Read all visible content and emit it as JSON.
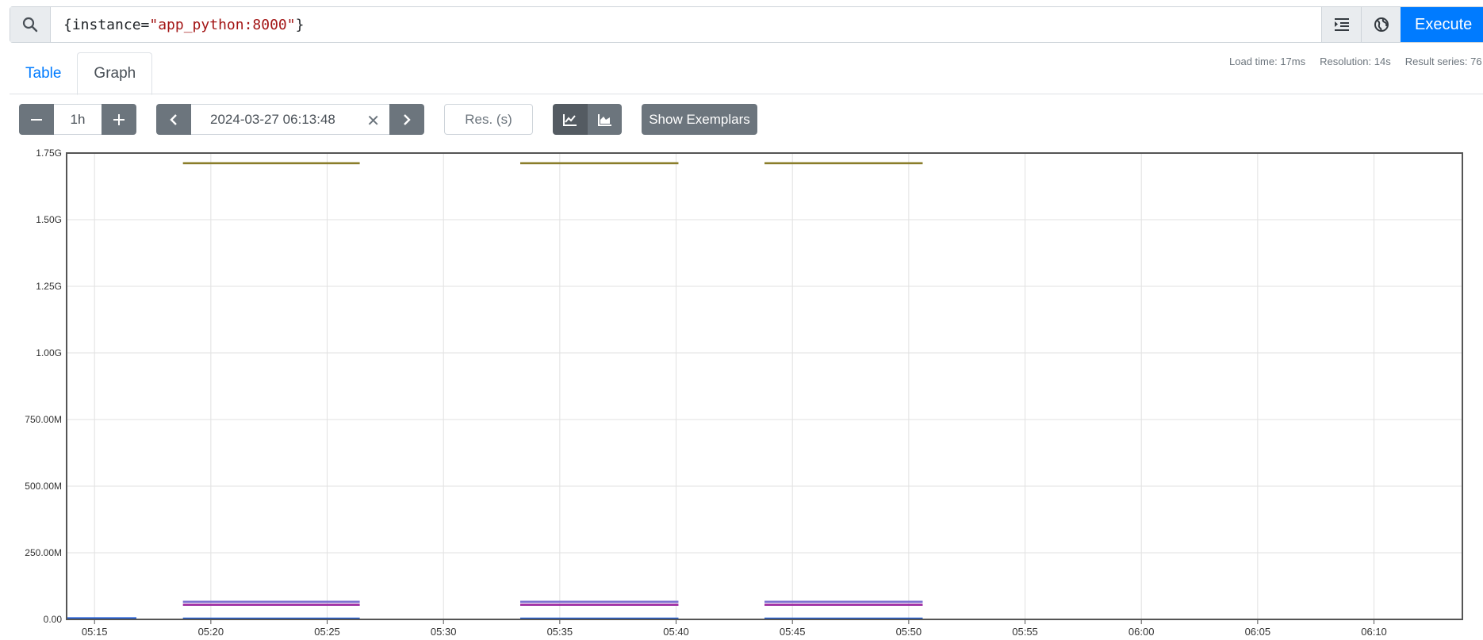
{
  "query": {
    "prefix": "{instance=",
    "string": "\"app_python:8000\"",
    "suffix": "}"
  },
  "buttons": {
    "execute": "Execute"
  },
  "tabs": [
    {
      "label": "Table",
      "active": false
    },
    {
      "label": "Graph",
      "active": true
    }
  ],
  "stats": {
    "load_time": "Load time: 17ms",
    "resolution": "Resolution: 14s",
    "result_series": "Result series: 76"
  },
  "controls": {
    "range": "1h",
    "end_time": "2024-03-27 06:13:48",
    "resolution_placeholder": "Res. (s)",
    "show_exemplars": "Show Exemplars"
  },
  "colors": {
    "accent": "#007bff",
    "button_dark": "#6c757d"
  },
  "chart_data": {
    "type": "line",
    "y_tick_labels": [
      "0.00",
      "250.00M",
      "500.00M",
      "750.00M",
      "1.00G",
      "1.25G",
      "1.50G",
      "1.75G"
    ],
    "y_tick_values": [
      0,
      250000000,
      500000000,
      750000000,
      1000000000,
      1250000000,
      1500000000,
      1750000000
    ],
    "ylim": [
      0,
      1750000000
    ],
    "x_tick_labels": [
      "05:15",
      "05:20",
      "05:25",
      "05:30",
      "05:35",
      "05:40",
      "05:45",
      "05:50",
      "05:55",
      "06:00",
      "06:05",
      "06:10"
    ],
    "x_tick_minutes": [
      315,
      320,
      325,
      330,
      335,
      340,
      345,
      350,
      355,
      360,
      365,
      370
    ],
    "xlim_minutes": [
      313.8,
      373.8
    ],
    "grid": true,
    "segments": [
      {
        "start": 313.8,
        "end": 316.8,
        "color": "#1f5bd6",
        "values": [
          4000000
        ]
      },
      {
        "start": 318.8,
        "end": 326.4,
        "color": "#8a7d2a",
        "values": [
          1712000000
        ]
      },
      {
        "start": 318.8,
        "end": 326.4,
        "color": "#7b6fd0",
        "values": [
          66000000
        ]
      },
      {
        "start": 318.8,
        "end": 326.4,
        "color": "#9c27a0",
        "values": [
          55000000
        ]
      },
      {
        "start": 318.8,
        "end": 326.4,
        "color": "#1f5bd6",
        "values": [
          3000000
        ]
      },
      {
        "start": 333.3,
        "end": 340.1,
        "color": "#8a7d2a",
        "values": [
          1712000000
        ]
      },
      {
        "start": 333.3,
        "end": 340.1,
        "color": "#7b6fd0",
        "values": [
          66000000
        ]
      },
      {
        "start": 333.3,
        "end": 340.1,
        "color": "#9c27a0",
        "values": [
          55000000
        ]
      },
      {
        "start": 333.3,
        "end": 340.1,
        "color": "#1f5bd6",
        "values": [
          3000000
        ]
      },
      {
        "start": 343.8,
        "end": 350.6,
        "color": "#8a7d2a",
        "values": [
          1712000000
        ]
      },
      {
        "start": 343.8,
        "end": 350.6,
        "color": "#7b6fd0",
        "values": [
          66000000
        ]
      },
      {
        "start": 343.8,
        "end": 350.6,
        "color": "#9c27a0",
        "values": [
          55000000
        ]
      },
      {
        "start": 343.8,
        "end": 350.6,
        "color": "#1f5bd6",
        "values": [
          3000000
        ]
      }
    ]
  }
}
